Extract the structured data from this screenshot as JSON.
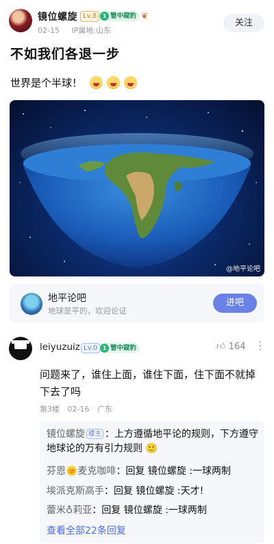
{
  "post": {
    "author": "镜位螺旋",
    "level": "Lv.8",
    "badge": "管中窥豹",
    "badge_num": "1",
    "date": "02-15",
    "ip": "IP属地:山东",
    "follow_label": "关注",
    "title": "不如我们各退一步",
    "text": "世界是个半球！",
    "image_watermark": "@地平论吧"
  },
  "forum": {
    "name": "地平论吧",
    "desc": "地球是平的，欢迎论证",
    "enter_label": "进吧"
  },
  "comment": {
    "author": "leiyuzuiz",
    "level": "Lv.0",
    "badge": "管中窥豹",
    "badge_num": "1",
    "likes": "164",
    "text": "问题来了，谁住上面，谁住下面，住下面不就掉下去了吗",
    "floor": "第3楼",
    "date": "02-16",
    "location": "广东",
    "replies": [
      {
        "name": "镜位螺旋",
        "tag": "楼主",
        "text": "：上方遵循地平论的规则，下方遵守地球论的万有引力规则 🙂"
      },
      {
        "name": "芬恩🌞麦克咖啡",
        "text": "：回复 镜位螺旋 :一球两制"
      },
      {
        "name": "埃派克斯高手",
        "text": "：回复 镜位螺旋 :天才!"
      },
      {
        "name": "蕾米♁莉亚",
        "text": "：回复 镜位螺旋 :一球两制"
      }
    ],
    "view_all": "查看全部22条回复"
  }
}
